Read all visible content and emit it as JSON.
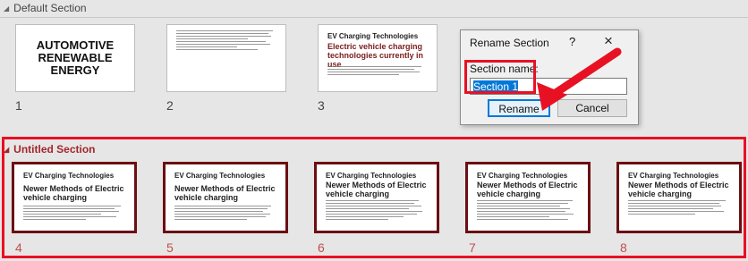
{
  "sections": [
    {
      "name": "Default Section"
    },
    {
      "name": "Untitled Section"
    }
  ],
  "slides": {
    "s1": {
      "number": "1",
      "title_lines": [
        "AUTOMOTIVE",
        "RENEWABLE",
        "ENERGY"
      ]
    },
    "s2": {
      "number": "2"
    },
    "s3": {
      "number": "3",
      "title": "EV Charging Technologies",
      "subtitle": "Electric vehicle charging technologies currently in use"
    },
    "s4": {
      "number": "4",
      "title": "EV Charging Technologies",
      "subtitle": "Newer Methods of Electric vehicle charging"
    },
    "s5": {
      "number": "5",
      "title": "EV Charging Technologies",
      "subtitle": "Newer Methods of Electric vehicle charging"
    },
    "s6": {
      "number": "6",
      "title": "EV Charging Technologies",
      "subtitle": "Newer Methods of Electric vehicle charging"
    },
    "s7": {
      "number": "7",
      "title": "EV Charging Technologies",
      "subtitle": "Newer Methods of Electric vehicle charging"
    },
    "s8": {
      "number": "8",
      "title": "EV Charging Technologies",
      "subtitle": "Newer Methods of Electric vehicle charging"
    }
  },
  "dialog": {
    "title": "Rename Section",
    "help": "?",
    "close": "×",
    "label": "Section name:",
    "input_value": "Section 1",
    "rename_button": "Rename",
    "cancel_button": "Cancel"
  },
  "icons": {
    "collapse": "collapse-triangle-icon",
    "close": "close-icon",
    "help": "help-icon"
  },
  "colors": {
    "highlight": "#e81123",
    "selected_border": "#6b0f12",
    "section_title": "#a4262c",
    "selection": "#0078d7"
  }
}
